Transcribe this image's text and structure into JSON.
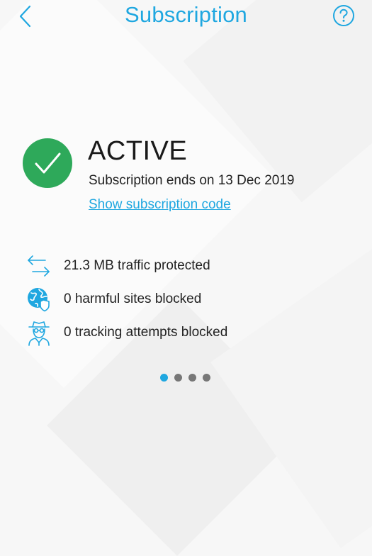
{
  "header": {
    "title": "Subscription",
    "back_icon": "chevron-left-icon",
    "help_icon": "help-circle-icon"
  },
  "status": {
    "state": "ACTIVE",
    "ends_text": "Subscription ends on 13 Dec 2019",
    "code_link": "Show subscription code",
    "icon": "check-circle-icon"
  },
  "stats": [
    {
      "icon": "arrows-exchange-icon",
      "label": "21.3 MB traffic protected"
    },
    {
      "icon": "globe-shield-icon",
      "label": "0 harmful sites blocked"
    },
    {
      "icon": "spy-icon",
      "label": "0 tracking attempts blocked"
    }
  ],
  "pager": {
    "count": 4,
    "active_index": 0
  },
  "colors": {
    "accent": "#1fa7e0",
    "success": "#2ea95a",
    "dot_inactive": "#777777"
  }
}
